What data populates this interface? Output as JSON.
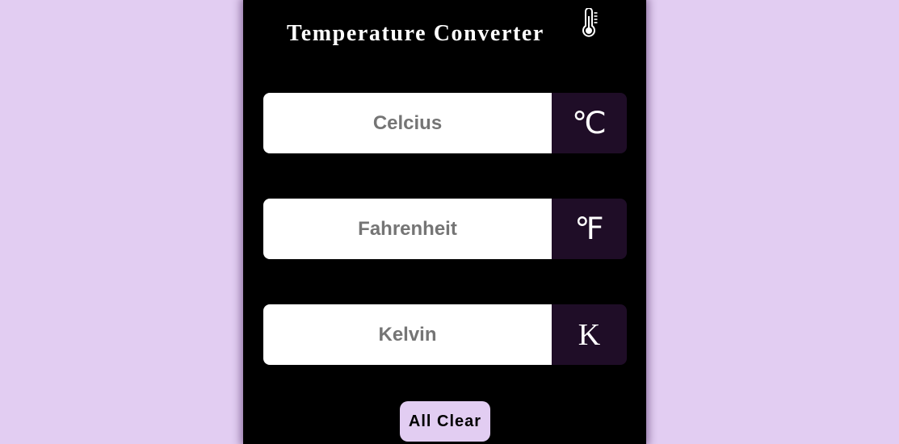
{
  "app": {
    "title": "Temperature Converter",
    "title_icon": "thermometer-icon"
  },
  "colors": {
    "page_background": "#e2cdf2",
    "panel_background": "#000000",
    "unit_background": "#1f0d27",
    "title_text": "#ffffff",
    "input_background": "#ffffff",
    "placeholder_text": "#757575",
    "button_background": "#e2cdf2"
  },
  "fields": {
    "celsius": {
      "placeholder": "Celcius",
      "value": "",
      "unit": "℃"
    },
    "fahrenheit": {
      "placeholder": "Fahrenheit",
      "value": "",
      "unit": "℉"
    },
    "kelvin": {
      "placeholder": "Kelvin",
      "value": "",
      "unit": "K"
    }
  },
  "actions": {
    "clear_label": "All Clear"
  }
}
